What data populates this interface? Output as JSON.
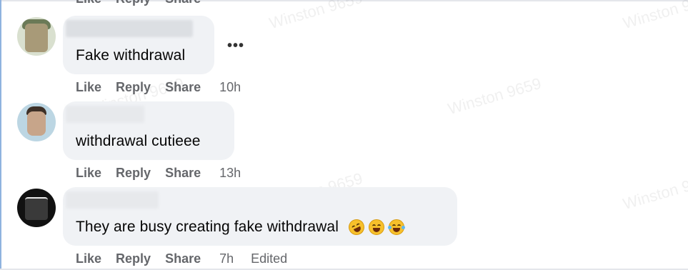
{
  "watermark": "Winston 9659",
  "actions": {
    "like": "Like",
    "reply": "Reply",
    "share": "Share"
  },
  "comments": [
    {
      "text": "Fake withdrawal",
      "time": "10h",
      "more": "•••"
    },
    {
      "text": "withdrawal cutieee",
      "time": "13h"
    },
    {
      "text": "They are busy creating fake withdrawal",
      "time": "7h",
      "edited": "Edited",
      "emojis": [
        "rolling-on-floor-laughing-icon",
        "grinning-squinting-icon",
        "tears-of-joy-icon"
      ]
    }
  ],
  "colors": {
    "bubble": "#f0f2f5",
    "action_text": "#65676b",
    "comment_text": "#050505"
  }
}
